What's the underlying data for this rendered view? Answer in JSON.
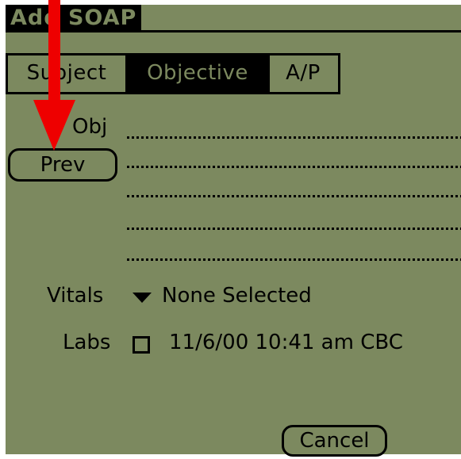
{
  "app": {
    "title": "Add SOAP"
  },
  "tabs": [
    {
      "label": "Subject",
      "selected": false
    },
    {
      "label": "Objective",
      "selected": true
    },
    {
      "label": "A/P",
      "selected": false
    }
  ],
  "objective": {
    "obj_label": "Obj",
    "prev_button": "Prev",
    "vitals_label": "Vitals",
    "vitals_value": "None Selected",
    "labs_label": "Labs",
    "labs_checked": false,
    "labs_value": "11/6/00 10:41 am CBC"
  },
  "footer": {
    "cancel_button": "Cancel"
  },
  "annotation": {
    "arrow_color": "#ee0000"
  },
  "colors": {
    "lcd_background": "#7c895f",
    "ink": "#000000"
  }
}
